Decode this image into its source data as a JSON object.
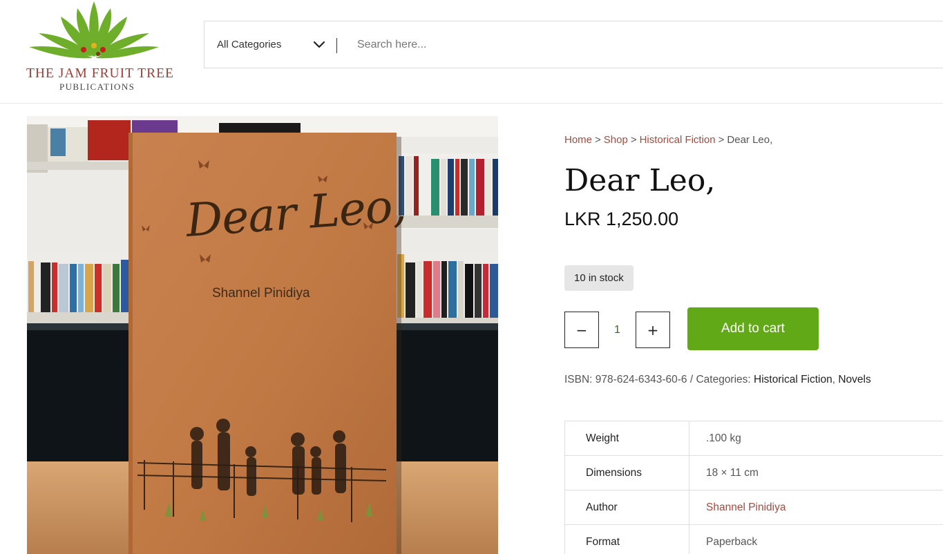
{
  "brand": {
    "name_line1": "THE JAM FRUIT TREE",
    "name_line2": "PUBLICATIONS"
  },
  "search": {
    "category_selected": "All Categories",
    "placeholder": "Search here..."
  },
  "product_image": {
    "cover_title": "Dear Leo,",
    "cover_author": "Shannel Pinidiya"
  },
  "breadcrumb": {
    "items": [
      "Home",
      "Shop",
      "Historical Fiction"
    ],
    "separator": ">",
    "current": "Dear Leo,"
  },
  "product": {
    "title": "Dear Leo,",
    "price": "LKR 1,250.00",
    "stock": "10 in stock",
    "quantity": "1",
    "minus_label": "−",
    "plus_label": "+",
    "add_to_cart_label": "Add to cart"
  },
  "meta": {
    "isbn_label": "ISBN:",
    "isbn_value": "978-624-6343-60-6",
    "divider": "/",
    "categories_label": "Categories:",
    "categories": [
      "Historical Fiction",
      "Novels"
    ]
  },
  "attributes": [
    {
      "key": "Weight",
      "value": ".100 kg"
    },
    {
      "key": "Dimensions",
      "value": "18 × 11 cm"
    },
    {
      "key": "Author",
      "value": "Shannel Pinidiya"
    },
    {
      "key": "Format",
      "value": "Paperback"
    }
  ],
  "colors": {
    "accent_green": "#62a918",
    "link_red": "#a44a3f",
    "logo_red": "#a23b35",
    "leaf_green": "#6fae2a"
  },
  "icons": {
    "category_dropdown": "chevron-down-icon",
    "logo": "tree-leaves-icon"
  }
}
